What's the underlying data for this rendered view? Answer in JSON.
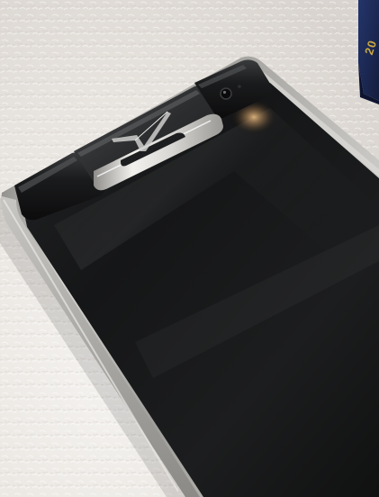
{
  "scene": {
    "description_hidden": "",
    "box_label": "20",
    "colors": {
      "fabric": "#ebe7e2",
      "bezel_steel": "#b8b7b4",
      "screen": "#141515",
      "ceramic": "#161718",
      "box_navy": "#1b2850",
      "box_gold": "#c9a843"
    },
    "icons": {
      "logo": "vertu-v-logo",
      "camera": "front-camera-icon"
    }
  }
}
